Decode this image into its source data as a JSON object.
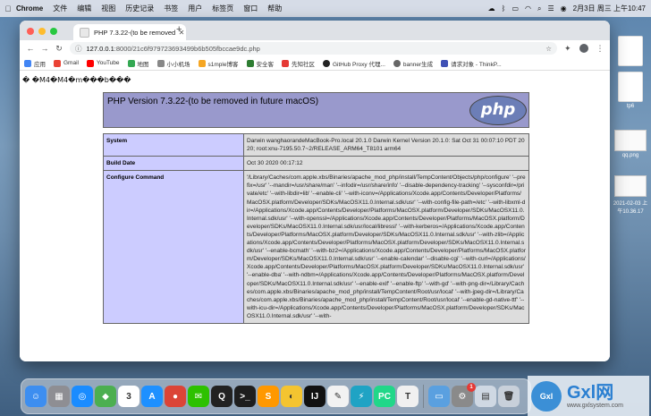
{
  "menubar": {
    "app": "Chrome",
    "items": [
      "文件",
      "编辑",
      "视图",
      "历史记录",
      "书签",
      "用户",
      "标签页",
      "窗口",
      "帮助"
    ],
    "datetime": "2月3日 周三 上午10:47"
  },
  "desktop": {
    "icons": [
      {
        "label": "",
        "kind": "file"
      },
      {
        "label": "tp6",
        "kind": "file"
      },
      {
        "label": "qq.png",
        "kind": "image"
      },
      {
        "label": "2021-02-03 上午10.36.17",
        "kind": "image"
      }
    ]
  },
  "browser": {
    "tab_title": "PHP 7.3.22-(to be removed in f",
    "new_tab_symbol": "+",
    "url_host": "127.0.0.1",
    "url_path": ":8000/21c6f979723693499b6b505fbccae9dc.php",
    "bookmarks": [
      {
        "label": "应用",
        "color": "#4285f4"
      },
      {
        "label": "Gmail",
        "color": "#ea4335"
      },
      {
        "label": "YouTube",
        "color": "#ff0000"
      },
      {
        "label": "地图",
        "color": "#34a853"
      },
      {
        "label": "小小机场",
        "color": "#888888"
      },
      {
        "label": "s1mple博客",
        "color": "#f5a623"
      },
      {
        "label": "安全客",
        "color": "#2e7d32"
      },
      {
        "label": "先知社区",
        "color": "#e53935"
      },
      {
        "label": "GitHub Proxy 代理...",
        "color": "#222222"
      },
      {
        "label": "banner生成",
        "color": "#666666"
      },
      {
        "label": "请求对象 - ThinkP...",
        "color": "#3f51b5"
      }
    ]
  },
  "page": {
    "garbled_text": "� �M4�M4�m���b���",
    "php_header": "PHP Version 7.3.22-(to be removed in future macOS)",
    "logo_text": "php",
    "rows": [
      {
        "key": "System",
        "value": "Darwin wanghaorandeMacBook-Pro.local 20.1.0 Darwin Kernel Version 20.1.0: Sat Oct 31 00:07:10 PDT 2020; root:xnu-7195.50.7~2/RELEASE_ARM64_T8101 arm64"
      },
      {
        "key": "Build Date",
        "value": "Oct 30 2020 00:17:12"
      },
      {
        "key": "Configure Command",
        "value": "'/Library/Caches/com.apple.xbs/Binaries/apache_mod_php/install/TempContent/Objects/php/configure' '--prefix=/usr' '--mandir=/usr/share/man' '--infodir=/usr/share/info' '--disable-dependency-tracking' '--sysconfdir=/private/etc' '--with-libdir=lib' '--enable-cli' '--with-iconv=/Applications/Xcode.app/Contents/Developer/Platforms/MacOSX.platform/Developer/SDKs/MacOSX11.0.Internal.sdk/usr' '--with-config-file-path=/etc' '--with-libxml-dir=/Applications/Xcode.app/Contents/Developer/Platforms/MacOSX.platform/Developer/SDKs/MacOSX11.0.Internal.sdk/usr' '--with-openssl=/Applications/Xcode.app/Contents/Developer/Platforms/MacOSX.platform/Developer/SDKs/MacOSX11.0.Internal.sdk/usr/local/libressl' '--with-kerberos=/Applications/Xcode.app/Contents/Developer/Platforms/MacOSX.platform/Developer/SDKs/MacOSX11.0.Internal.sdk/usr' '--with-zlib=/Applications/Xcode.app/Contents/Developer/Platforms/MacOSX.platform/Developer/SDKs/MacOSX11.0.Internal.sdk/usr' '--enable-bcmath' '--with-bz2=/Applications/Xcode.app/Contents/Developer/Platforms/MacOSX.platform/Developer/SDKs/MacOSX11.0.Internal.sdk/usr' '--enable-calendar' '--disable-cgi' '--with-curl=/Applications/Xcode.app/Contents/Developer/Platforms/MacOSX.platform/Developer/SDKs/MacOSX11.0.Internal.sdk/usr' '--enable-dba' '--with-ndbm=/Applications/Xcode.app/Contents/Developer/Platforms/MacOSX.platform/Developer/SDKs/MacOSX11.0.Internal.sdk/usr' '--enable-exif' '--enable-ftp' '--with-gd' '--with-png-dir=/Library/Caches/com.apple.xbs/Binaries/apache_mod_php/install/TempContent/Root/usr/local' '--with-jpeg-dir=/Library/Caches/com.apple.xbs/Binaries/apache_mod_php/install/TempContent/Root/usr/local' '--enable-gd-native-ttf' '--with-icu-dir=/Applications/Xcode.app/Contents/Developer/Platforms/MacOSX.platform/Developer/SDKs/MacOSX11.0.Internal.sdk/usr' '--with-"
      }
    ]
  },
  "dock": {
    "apps": [
      {
        "name": "finder",
        "glyph": "☺",
        "color": "#3d8ef0"
      },
      {
        "name": "launchpad",
        "glyph": "▦",
        "color": "#8e8e93"
      },
      {
        "name": "safari",
        "glyph": "◎",
        "color": "#1a8cff"
      },
      {
        "name": "maps",
        "glyph": "◆",
        "color": "#4caf50"
      },
      {
        "name": "calendar",
        "glyph": "3",
        "color": "#ffffff"
      },
      {
        "name": "app-store",
        "glyph": "A",
        "color": "#1e90ff"
      },
      {
        "name": "chrome",
        "glyph": "●",
        "color": "#db4437"
      },
      {
        "name": "wechat",
        "glyph": "✉",
        "color": "#2dc100"
      },
      {
        "name": "qq",
        "glyph": "Q",
        "color": "#222222"
      },
      {
        "name": "terminal",
        "glyph": ">_",
        "color": "#1e1e1e"
      },
      {
        "name": "sublime-text",
        "glyph": "S",
        "color": "#ff9800"
      },
      {
        "name": "app-yellow",
        "glyph": "◐",
        "color": "#f4c430"
      },
      {
        "name": "intellij",
        "glyph": "IJ",
        "color": "#111111"
      },
      {
        "name": "notes",
        "glyph": "✎",
        "color": "#f2f2f2"
      },
      {
        "name": "app-lightning",
        "glyph": "⚡",
        "color": "#1fa3c4"
      },
      {
        "name": "pycharm",
        "glyph": "PC",
        "color": "#21d789"
      },
      {
        "name": "typora",
        "glyph": "T",
        "color": "#f0f0f0"
      },
      {
        "name": "preview",
        "glyph": "▭",
        "color": "#5aa0e0"
      },
      {
        "name": "system-preferences",
        "glyph": "⚙",
        "color": "#8a8a8a"
      },
      {
        "name": "finder-window",
        "glyph": "▤",
        "color": "#cfd8e3"
      },
      {
        "name": "trash",
        "glyph": "🗑",
        "color": "#c8d0da"
      }
    ],
    "badge": "1"
  },
  "watermark": {
    "logo": "Gxl",
    "title": "Gxl网",
    "subtitle": "www.gxlsystem.com"
  }
}
